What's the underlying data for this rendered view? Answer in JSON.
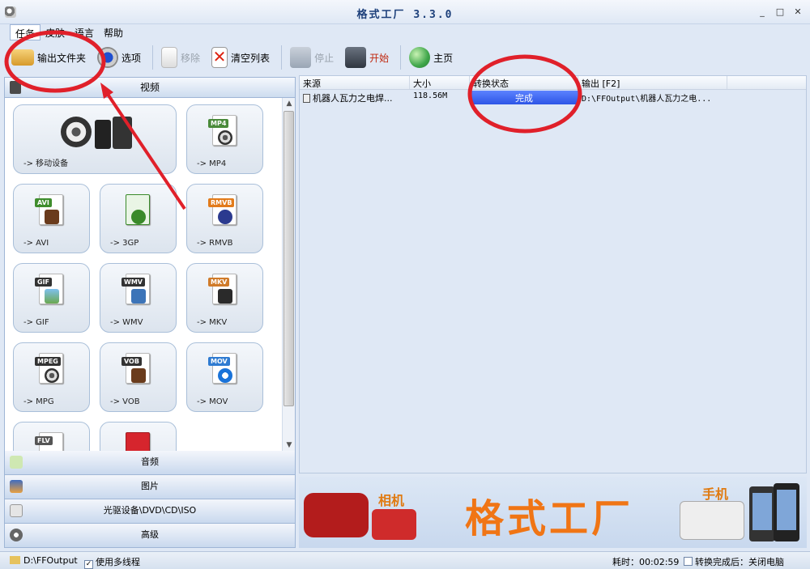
{
  "window": {
    "title": "格式工厂 3.3.0",
    "minimize": "_",
    "maximize": "□",
    "close": "✕"
  },
  "menu": {
    "items": [
      "任务",
      "皮肤",
      "语言",
      "帮助"
    ]
  },
  "toolbar": {
    "output_folder": "输出文件夹",
    "options": "选项",
    "remove": "移除",
    "clear_list": "清空列表",
    "stop": "停止",
    "start": "开始",
    "home": "主页"
  },
  "left": {
    "video_header": "视频",
    "formats": [
      {
        "label": "-> 移动设备",
        "tag": ""
      },
      {
        "label": "-> MP4",
        "tag": "MP4"
      },
      {
        "label": "-> AVI",
        "tag": "AVI"
      },
      {
        "label": "-> 3GP",
        "tag": "3GP"
      },
      {
        "label": "-> RMVB",
        "tag": "RMVB"
      },
      {
        "label": "-> GIF",
        "tag": "GIF"
      },
      {
        "label": "-> WMV",
        "tag": "WMV"
      },
      {
        "label": "-> MKV",
        "tag": "MKV"
      },
      {
        "label": "-> MPG",
        "tag": "MPEG"
      },
      {
        "label": "-> VOB",
        "tag": "VOB"
      },
      {
        "label": "-> MOV",
        "tag": "MOV"
      },
      {
        "label": "",
        "tag": "FLV"
      }
    ],
    "categories": [
      "音频",
      "图片",
      "光驱设备\\DVD\\CD\\ISO",
      "高级"
    ]
  },
  "grid": {
    "headers": [
      "来源",
      "大小",
      "转换状态",
      "输出 [F2]"
    ],
    "rows": [
      {
        "source": "机器人瓦力之电焊...",
        "size": "118.56M",
        "status": "完成",
        "output": "D:\\FFOutput\\机器人瓦力之电..."
      }
    ]
  },
  "banner": {
    "camera_label": "相机",
    "brand": "格式工厂",
    "phone_label": "手机"
  },
  "status": {
    "path": "D:\\FFOutput",
    "multithread": "使用多线程",
    "elapsed": "耗时：00:02:59",
    "after_done": "转换完成后：关闭电脑"
  },
  "colors": {
    "accent": "#2d55e6",
    "annotation": "#e0202a",
    "brand": "#f07515"
  }
}
